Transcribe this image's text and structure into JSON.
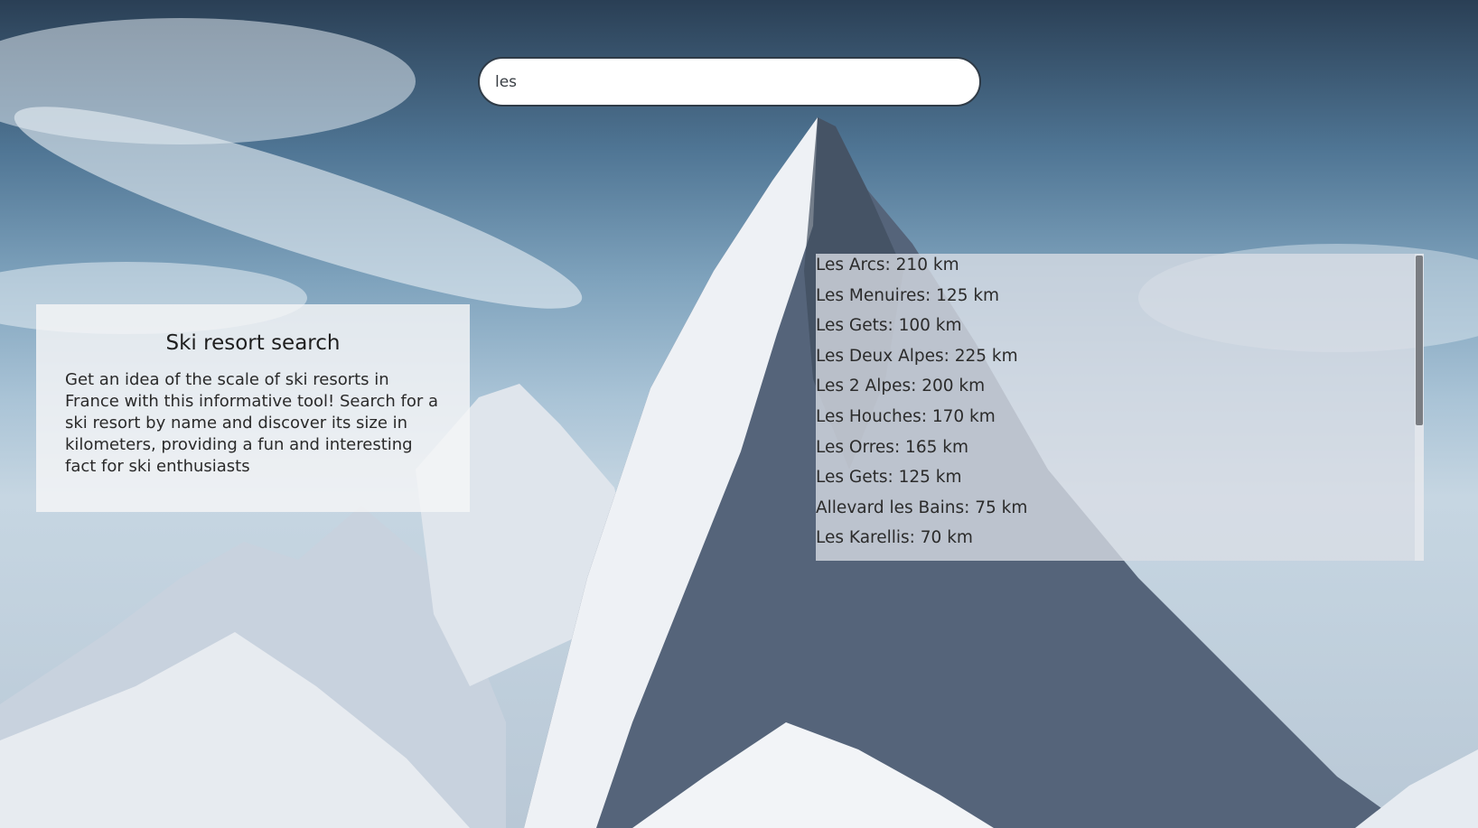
{
  "search": {
    "value": "les",
    "placeholder": ""
  },
  "info": {
    "title": "Ski resort search",
    "description": "Get an idea of the scale of ski resorts in France with this informative tool! Search for a ski resort by name and discover its size in kilometers, providing a fun and interesting fact for ski enthusiasts"
  },
  "results": [
    "Les Arcs: 210 km",
    "Les Menuires: 125 km",
    "Les Gets: 100 km",
    "Les Deux Alpes: 225 km",
    "Les 2 Alpes: 200 km",
    "Les Houches: 170 km",
    "Les Orres: 165 km",
    "Les Gets: 125 km",
    "Allevard les Bains: 75 km",
    "Les Karellis: 70 km"
  ],
  "colors": {
    "search_border": "#2f3b47",
    "results_panel": "#dadee6",
    "info_panel": "#f5f5f6"
  }
}
